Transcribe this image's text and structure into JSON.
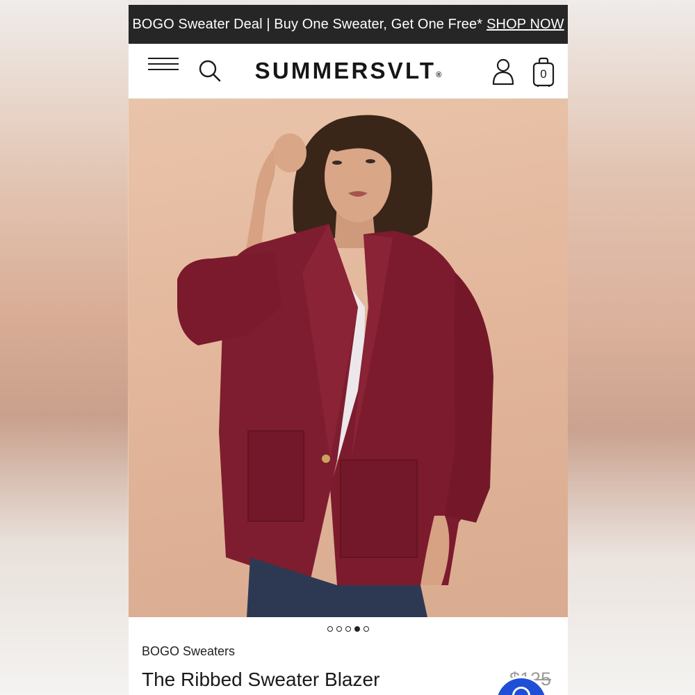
{
  "promo": {
    "text": "BOGO Sweater Deal | Buy One Sweater, Get One Free*",
    "link": "SHOP NOW"
  },
  "header": {
    "logo": "SUMMERSVLT",
    "logo_mark": "®",
    "cart_count": "0",
    "icons": [
      "menu-icon",
      "search-icon",
      "user-icon",
      "shopping-bag-icon"
    ]
  },
  "product": {
    "category": "BOGO Sweaters",
    "name": "The Ribbed Sweater Blazer",
    "price": "$125",
    "image_colors": {
      "blazer": "#7e1d2f",
      "background": "#e6bea4",
      "top": "#ece7ea",
      "jeans": "#2d3953"
    }
  },
  "carousel": {
    "count": 5,
    "active_index": 3
  },
  "colors": {
    "promo_bar": "#262626",
    "accessibility_button": "#1f4fd6"
  }
}
